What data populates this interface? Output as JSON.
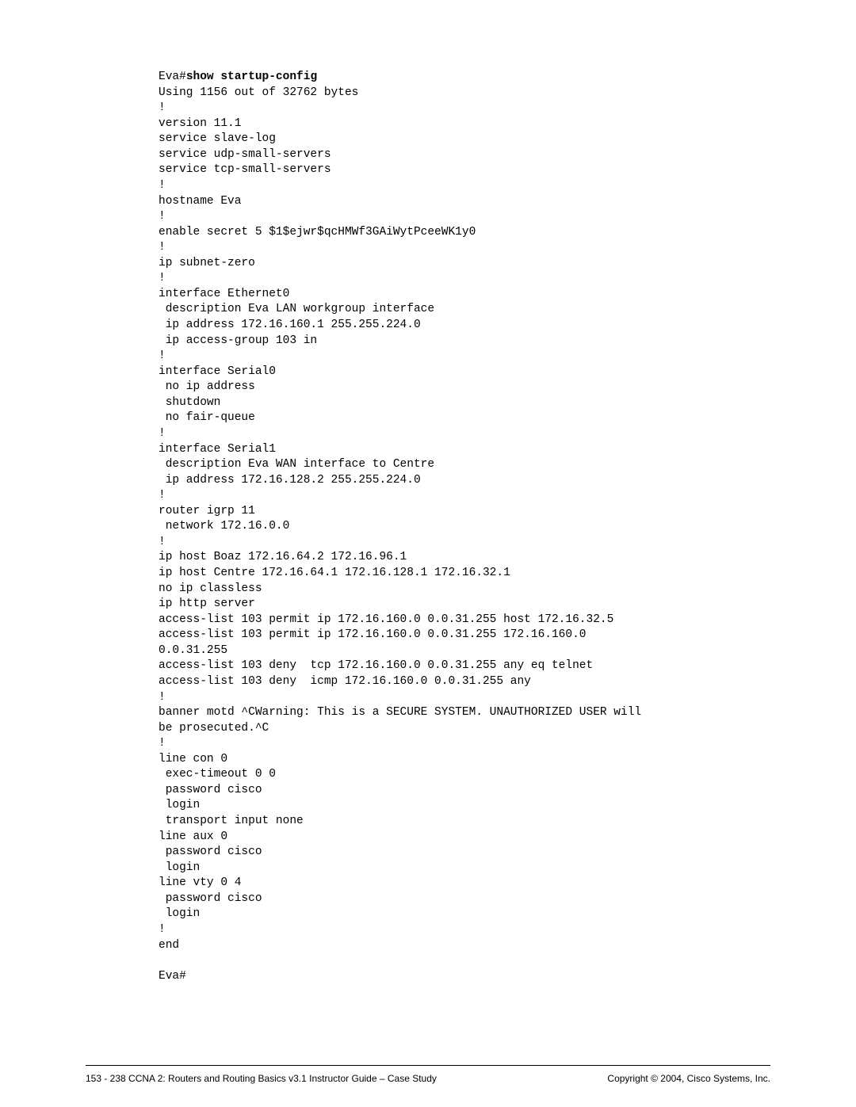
{
  "terminal": {
    "prompt": "Eva#",
    "command": "show startup-config",
    "output": "Using 1156 out of 32762 bytes\n!\nversion 11.1\nservice slave-log\nservice udp-small-servers\nservice tcp-small-servers\n!\nhostname Eva\n!\nenable secret 5 $1$ejwr$qcHMWf3GAiWytPceeWK1y0\n!\nip subnet-zero\n!\ninterface Ethernet0\n description Eva LAN workgroup interface\n ip address 172.16.160.1 255.255.224.0\n ip access-group 103 in\n!\ninterface Serial0\n no ip address\n shutdown\n no fair-queue\n!\ninterface Serial1\n description Eva WAN interface to Centre\n ip address 172.16.128.2 255.255.224.0\n!\nrouter igrp 11\n network 172.16.0.0\n!\nip host Boaz 172.16.64.2 172.16.96.1\nip host Centre 172.16.64.1 172.16.128.1 172.16.32.1\nno ip classless\nip http server\naccess-list 103 permit ip 172.16.160.0 0.0.31.255 host 172.16.32.5\naccess-list 103 permit ip 172.16.160.0 0.0.31.255 172.16.160.0\n0.0.31.255\naccess-list 103 deny  tcp 172.16.160.0 0.0.31.255 any eq telnet\naccess-list 103 deny  icmp 172.16.160.0 0.0.31.255 any\n!\nbanner motd ^CWarning: This is a SECURE SYSTEM. UNAUTHORIZED USER will\nbe prosecuted.^C\n!\nline con 0\n exec-timeout 0 0\n password cisco\n login\n transport input none\nline aux 0\n password cisco\n login\nline vty 0 4\n password cisco\n login\n!\nend\n\nEva#"
  },
  "footer": {
    "left": "153 - 238   CCNA 2: Routers and Routing Basics v3.1 Instructor Guide – Case Study",
    "right": "Copyright © 2004, Cisco Systems, Inc."
  }
}
